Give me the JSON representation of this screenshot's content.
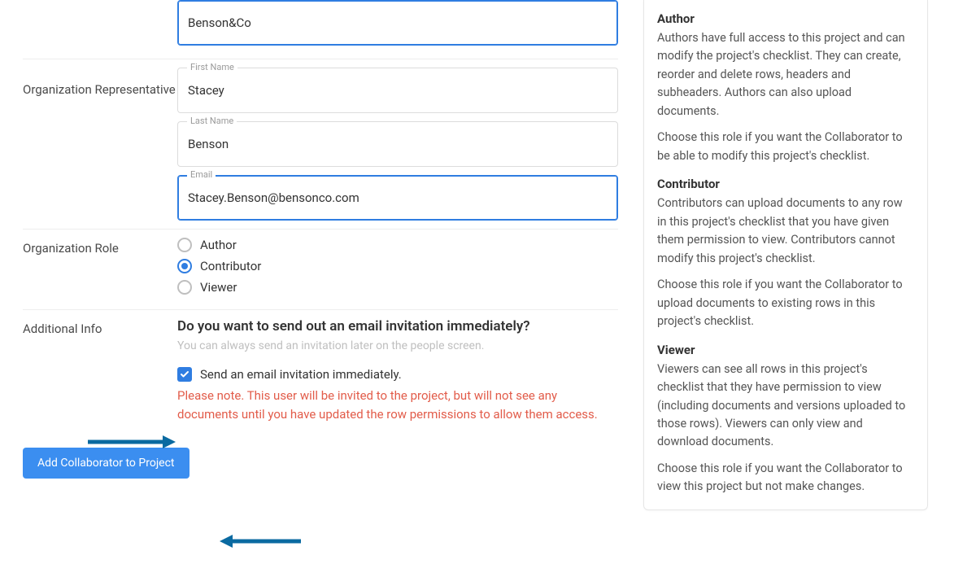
{
  "form": {
    "org_name": {
      "value": "Benson&Co"
    },
    "representative": {
      "label": "Organization Representative",
      "first_name_label": "First Name",
      "first_name": "Stacey",
      "last_name_label": "Last Name",
      "last_name": "Benson",
      "email_label": "Email",
      "email": "Stacey.Benson@bensonco.com"
    },
    "role": {
      "label": "Organization Role",
      "options": {
        "author": "Author",
        "contributor": "Contributor",
        "viewer": "Viewer"
      },
      "selected": "contributor"
    },
    "additional": {
      "label": "Additional Info",
      "heading": "Do you want to send out an email invitation immediately?",
      "sub": "You can always send an invitation later on the people screen.",
      "checkbox_label": "Send an email invitation immediately.",
      "checkbox_checked": true,
      "warning": "Please note. This user will be invited to the project, but will not see any documents until you have updated the row permissions to allow them access."
    },
    "submit_label": "Add Collaborator to Project"
  },
  "help": {
    "author": {
      "title": "Author",
      "body": "Authors have full access to this project and can modify the project's checklist. They can create, reorder and delete rows, headers and subheaders. Authors can also upload documents.",
      "hint": "Choose this role if you want the Collaborator to be able to modify this project's checklist."
    },
    "contributor": {
      "title": "Contributor",
      "body": "Contributors can upload documents to any row in this project's checklist that you have given them permission to view. Contributors cannot modify this project's checklist.",
      "hint": "Choose this role if you want the Collaborator to upload documents to existing rows in this project's checklist."
    },
    "viewer": {
      "title": "Viewer",
      "body": "Viewers can see all rows in this project's checklist that they have permission to view (including documents and versions uploaded to those rows). Viewers can only view and download documents.",
      "hint": "Choose this role if you want the Collaborator to view this project but not make changes."
    }
  }
}
